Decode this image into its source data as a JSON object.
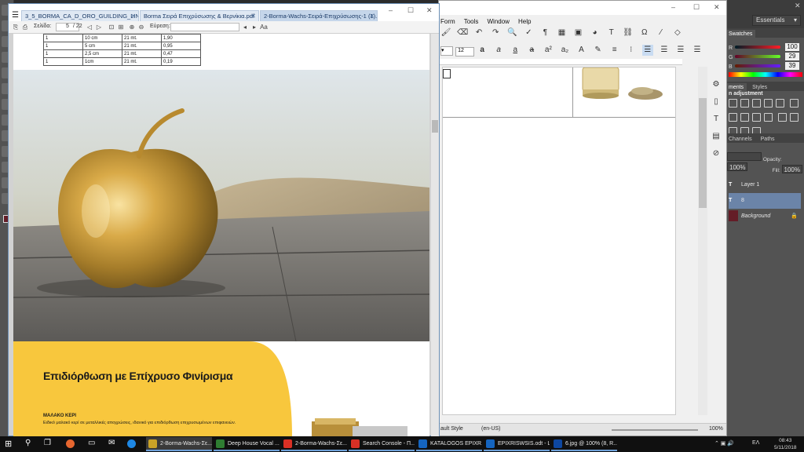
{
  "photoshop": {
    "workspace": "Essentials",
    "swatches_tab": "Swatches",
    "rgb": {
      "r_label": "R",
      "g_label": "G",
      "b_label": "B",
      "r": "100",
      "g": "29",
      "b": "39"
    },
    "adjustments_tabs": [
      "ments",
      "Styles"
    ],
    "adjustments_title": "n adjustment",
    "layers_tabs": [
      "Channels",
      "Paths"
    ],
    "opacity_label": "Opacity:",
    "opacity_value": "100%",
    "fill_label": "Fill:",
    "fill_value": "100%",
    "layers": [
      {
        "label": "Layer 1",
        "kind": "text"
      },
      {
        "label": "8",
        "kind": "text-selected"
      },
      {
        "label": "Background",
        "kind": "image"
      }
    ],
    "colors": {
      "foreground": "#641d27",
      "panel": "#535353"
    }
  },
  "writer": {
    "menu": [
      "Form",
      "Tools",
      "Window",
      "Help"
    ],
    "font_size": "12",
    "status_left": "ault Style",
    "status_lang": "(en-US)",
    "zoom": "100%"
  },
  "pdf": {
    "tabs": [
      {
        "label": "3_5_BORMA_CA_D_ORO_GUILDING_LINE.pdf"
      },
      {
        "label": "Borma Σειρά Επιχρύσωσης & Βερνίκια.pdf"
      },
      {
        "label": "2-Borma-Wachs-Σειρά-Επιχρύσωσης-1 (1).pdf"
      }
    ],
    "page_label": "Σελίδα:",
    "page_current": "5",
    "page_total": "/ 22",
    "find_label": "Εύρεση:",
    "table_rows": [
      [
        "1",
        "10 cm",
        "21 mt.",
        "1,90"
      ],
      [
        "1",
        "5 cm",
        "21 mt.",
        "0,95"
      ],
      [
        "1",
        "2,5 cm",
        "21 mt.",
        "0,47"
      ],
      [
        "1",
        "1cm",
        "21 mt.",
        "0,19"
      ]
    ],
    "headline": "Επιδιόρθωση με Επίχρυσο Φινίρισμα",
    "subhead": "ΜΑΛΑΚΟ ΚΕΡΙ",
    "body_text": "Ειδικό μαλακό κερί σε μεταλλικές αποχρώσεις, ιδανικό για επιδιόρθωση επιχρυσωμένων επιφανειών.",
    "colors": {
      "yellow": "#f8c73d",
      "accent_tab": "#6b8fb5"
    }
  },
  "taskbar": {
    "tasks": [
      {
        "label": "2-Borma-Wachs-Σε...",
        "color": "#c9a227"
      },
      {
        "label": "Deep House Vocal ...",
        "color": "#2f7d32"
      },
      {
        "label": "2-Borma-Wachs-Σε...",
        "color": "#d93025"
      },
      {
        "label": "Search Console - Π...",
        "color": "#d93025"
      },
      {
        "label": "KATALOGOS EPIXR...",
        "color": "#1565c0"
      },
      {
        "label": "EPIXRISWSIS.odt - L...",
        "color": "#1565c0"
      },
      {
        "label": "6.jpg @ 100% (8, R...",
        "color": "#0d47a1"
      }
    ],
    "language": "ΕΛ",
    "time": "08:43",
    "date": "5/11/2018"
  }
}
